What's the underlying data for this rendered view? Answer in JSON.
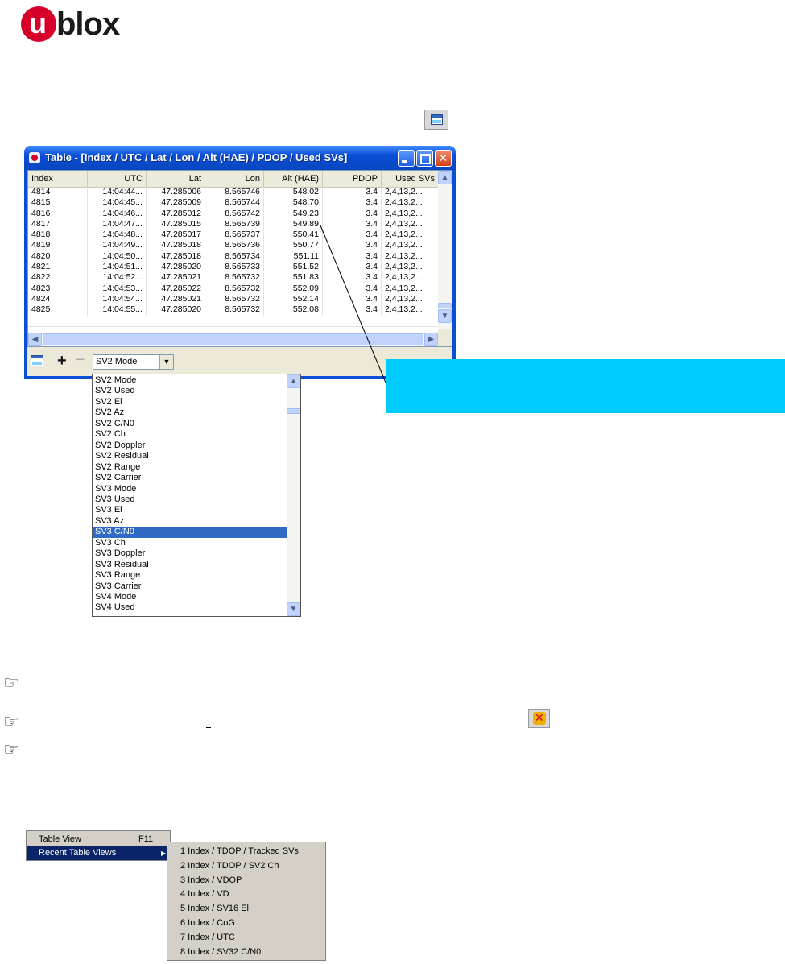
{
  "logo": {
    "text_u": "u",
    "text_rest": "blox"
  },
  "window": {
    "title": "Table - [Index / UTC / Lat / Lon / Alt (HAE) / PDOP / Used SVs]"
  },
  "table": {
    "columns": [
      "Index",
      "UTC",
      "Lat",
      "Lon",
      "Alt (HAE)",
      "PDOP",
      "Used SVs"
    ],
    "rows": [
      [
        "4814",
        "14:04:44...",
        "47.285006",
        "8.565746",
        "548.02",
        "3.4",
        "2,4,13,2..."
      ],
      [
        "4815",
        "14:04:45...",
        "47.285009",
        "8.565744",
        "548.70",
        "3.4",
        "2,4,13,2..."
      ],
      [
        "4816",
        "14:04:46...",
        "47.285012",
        "8.565742",
        "549.23",
        "3.4",
        "2,4,13,2..."
      ],
      [
        "4817",
        "14:04:47...",
        "47.285015",
        "8.565739",
        "549.89",
        "3.4",
        "2,4,13,2..."
      ],
      [
        "4818",
        "14:04:48...",
        "47.285017",
        "8.565737",
        "550.41",
        "3.4",
        "2,4,13,2..."
      ],
      [
        "4819",
        "14:04:49...",
        "47.285018",
        "8.565736",
        "550.77",
        "3.4",
        "2,4,13,2..."
      ],
      [
        "4820",
        "14:04:50...",
        "47.285018",
        "8.565734",
        "551.11",
        "3.4",
        "2,4,13,2..."
      ],
      [
        "4821",
        "14:04:51...",
        "47.285020",
        "8.565733",
        "551.52",
        "3.4",
        "2,4,13,2..."
      ],
      [
        "4822",
        "14:04:52...",
        "47.285021",
        "8.565732",
        "551.83",
        "3.4",
        "2,4,13,2..."
      ],
      [
        "4823",
        "14:04:53...",
        "47.285022",
        "8.565732",
        "552.09",
        "3.4",
        "2,4,13,2..."
      ],
      [
        "4824",
        "14:04:54...",
        "47.285021",
        "8.565732",
        "552.14",
        "3.4",
        "2,4,13,2..."
      ],
      [
        "4825",
        "14:04:55...",
        "47.285020",
        "8.565732",
        "552.08",
        "3.4",
        "2,4,13,2..."
      ]
    ]
  },
  "toolbar": {
    "add_label": "+",
    "remove_label": "−",
    "combo_value": "SV2 Mode"
  },
  "dropdown": {
    "items": [
      "SV2 Mode",
      "SV2 Used",
      "SV2 El",
      "SV2 Az",
      "SV2 C/N0",
      "SV2 Ch",
      "SV2 Doppler",
      "SV2 Residual",
      "SV2 Range",
      "SV2 Carrier",
      "SV3 Mode",
      "SV3 Used",
      "SV3 El",
      "SV3 Az",
      "SV3 C/N0",
      "SV3 Ch",
      "SV3 Doppler",
      "SV3 Residual",
      "SV3 Range",
      "SV3 Carrier",
      "SV4 Mode",
      "SV4 Used"
    ],
    "selected": "SV3 C/N0"
  },
  "menu": {
    "items": [
      {
        "label": "Table View",
        "shortcut": "F11"
      },
      {
        "label": "Recent Table Views",
        "shortcut": ""
      }
    ],
    "submenu": [
      "1 Index / TDOP / Tracked SVs",
      "2 Index / TDOP / SV2 Ch",
      "3 Index / VDOP",
      "4 Index / VD",
      "5 Index / SV16 El",
      "6 Index / CoG",
      "7 Index / UTC",
      "8 Index / SV32 C/N0"
    ]
  },
  "icons": {
    "hand": "pointing-hand-icon",
    "table": "table-view-icon",
    "close_all": "close-all-views-icon"
  },
  "colors": {
    "callout": "#00ccff",
    "titlebar": "#0a4fd6",
    "selection": "#316ac5",
    "menu_highlight": "#0a246a",
    "brand": "#d7002b"
  }
}
